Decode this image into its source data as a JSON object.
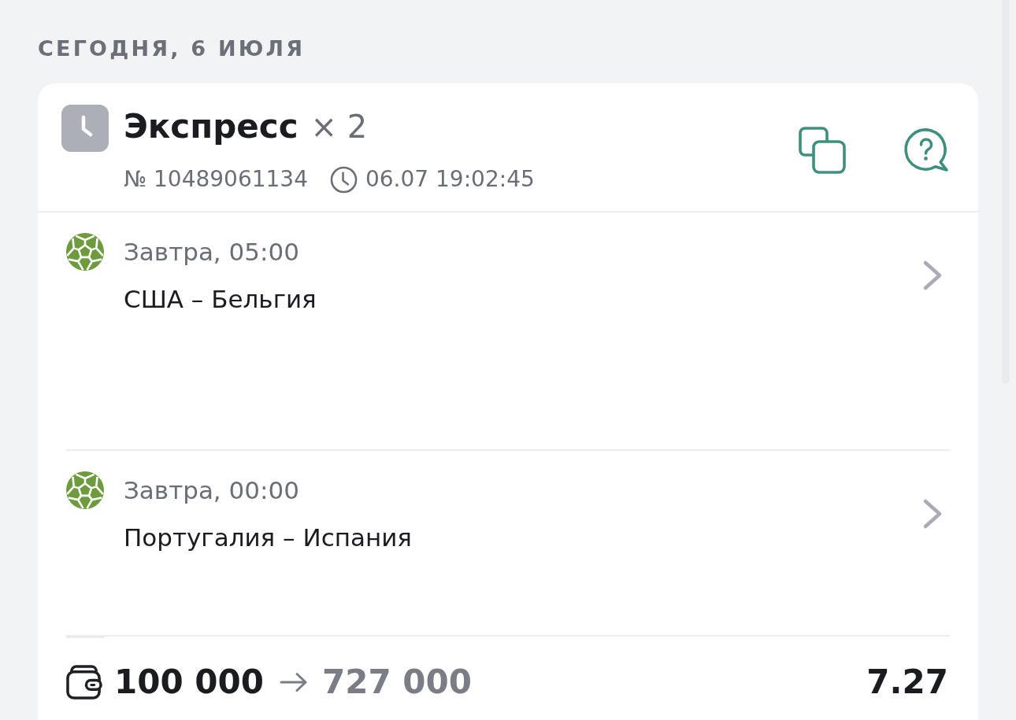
{
  "date_header": "СЕГОДНЯ, 6 ИЮЛЯ",
  "bet": {
    "title": "Экспресс",
    "multiplier": "× 2",
    "number": "№ 10489061134",
    "datetime": "06.07 19:02:45"
  },
  "events": [
    {
      "time": "Завтра, 05:00",
      "teams": "США – Бельгия"
    },
    {
      "time": "Завтра, 00:00",
      "teams": "Португалия – Испания"
    }
  ],
  "footer": {
    "stake": "100 000",
    "payout": "727 000",
    "odds": "7.27"
  }
}
